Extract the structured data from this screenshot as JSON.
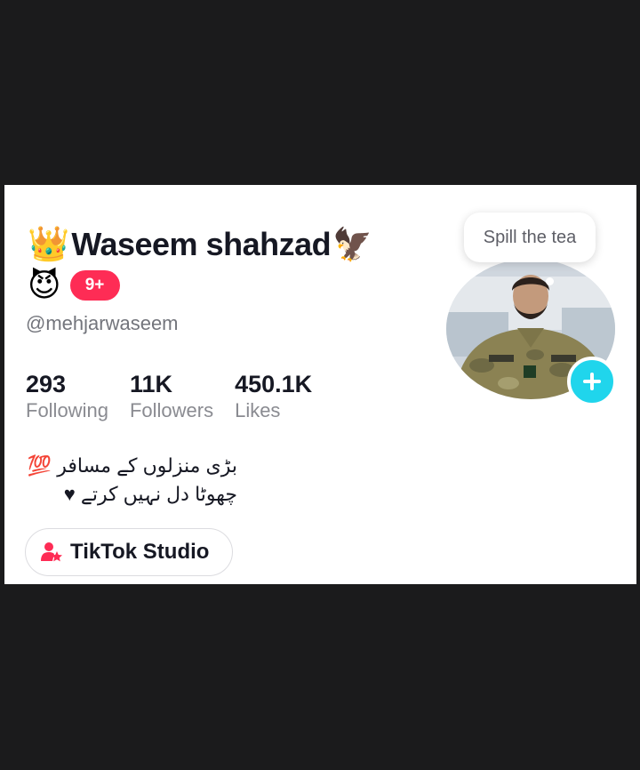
{
  "profile": {
    "crown_emoji": "👑",
    "display_name": "Waseem shahzad",
    "eagle_emoji": "🦅",
    "devil_emoji": "😈",
    "notification_badge": "9+",
    "username": "@mehjarwaseem"
  },
  "stats": [
    {
      "value": "293",
      "label": "Following"
    },
    {
      "value": "11K",
      "label": "Followers"
    },
    {
      "value": "450.1K",
      "label": "Likes"
    }
  ],
  "bio": {
    "line1": "بڑی منزلوں کے مسافر 💯",
    "line2": "چھوٹا دل نہیں کرتے ♥"
  },
  "studio_button": {
    "label": "TikTok Studio",
    "icon": "studio-icon"
  },
  "avatar": {
    "tooltip": "Spill the tea",
    "add_icon": "plus-icon"
  },
  "colors": {
    "accent": "#fe2c55",
    "add_button": "#20d5ec",
    "text": "#161823",
    "secondary": "#73757c"
  }
}
